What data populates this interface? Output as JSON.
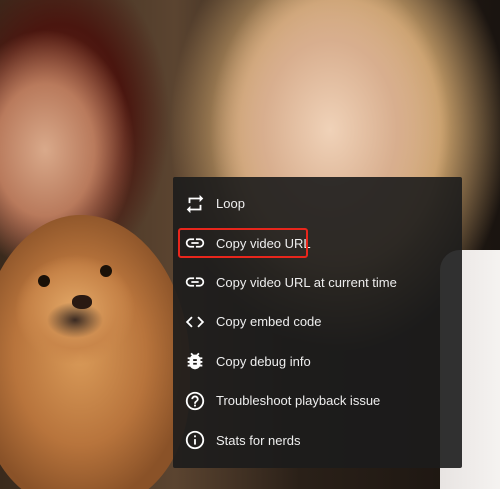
{
  "menu": {
    "items": [
      {
        "label": "Loop",
        "icon": "loop-icon"
      },
      {
        "label": "Copy video URL",
        "icon": "link-icon"
      },
      {
        "label": "Copy video URL at current time",
        "icon": "link-icon"
      },
      {
        "label": "Copy embed code",
        "icon": "code-icon"
      },
      {
        "label": "Copy debug info",
        "icon": "bug-icon"
      },
      {
        "label": "Troubleshoot playback issue",
        "icon": "help-icon"
      },
      {
        "label": "Stats for nerds",
        "icon": "info-icon"
      }
    ],
    "highlighted_item": "Copy video URL",
    "highlight_color": "#e8261c",
    "background_color": "#1c1c1c",
    "text_color": "#eeeeee"
  }
}
